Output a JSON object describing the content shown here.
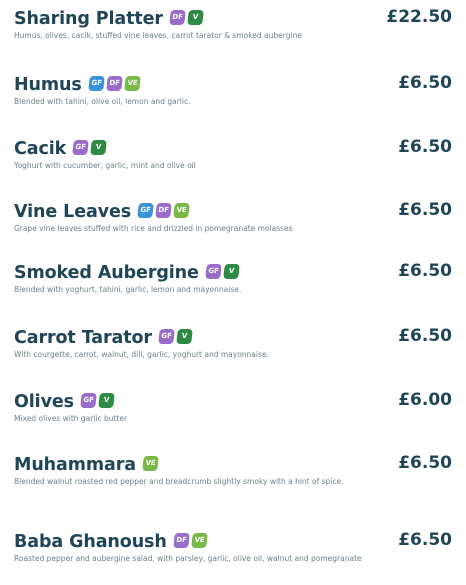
{
  "items": [
    {
      "name": "Sharing Platter",
      "price": "£22.50",
      "desc": "Humus, olives, cacik, stuffed vine leaves, carrot tarator & smoked aubergine",
      "tags": [
        "DF",
        "V"
      ]
    },
    {
      "name": "Humus",
      "price": "£6.50",
      "desc": "Blended with tahini, olive oil, lemon and garlic.",
      "tags": [
        "GF",
        "DF",
        "VE"
      ]
    },
    {
      "name": "Cacik",
      "price": "£6.50",
      "desc": "Yoghurt with cucumber, garlic, mint and olive oil",
      "tags": [
        "GF",
        "V"
      ]
    },
    {
      "name": "Vine Leaves",
      "price": "£6.50",
      "desc": "Grape vine leaves stuffed with rice and drizzled in pomegranate molasses",
      "tags": [
        "GF",
        "DF",
        "VE"
      ]
    },
    {
      "name": "Smoked Aubergine",
      "price": "£6.50",
      "desc": "Blended with yoghurt, tahini, garlic, lemon and mayonnaise.",
      "tags": [
        "GF",
        "V"
      ]
    },
    {
      "name": "Carrot Tarator",
      "price": "£6.50",
      "desc": "With courgette, carrot, walnut, dill, garlic, yoghurt and mayonnaise.",
      "tags": [
        "GF",
        "V"
      ]
    },
    {
      "name": "Olives",
      "price": "£6.00",
      "desc": "Mixed olives with garlic butter",
      "tags": [
        "GF",
        "V"
      ]
    },
    {
      "name": "Muhammara",
      "price": "£6.50",
      "desc": "Blended walnut roasted red pepper and breadcrumb slightly smoky with a hint of spice.",
      "tags": [
        "VE"
      ]
    },
    {
      "name": "Baba Ghanoush",
      "price": "£6.50",
      "desc": "Roasted pepper and aubergine salad, with parsley, garlic, olive oil, walnut and pomegranate",
      "tags": [
        "DF",
        "VE"
      ]
    }
  ],
  "colors": {
    "heading": "#1f4556",
    "GF": "#3a93d8",
    "DF": "#9a6cc9",
    "V": "#2e8a44",
    "VE": "#79b947"
  }
}
